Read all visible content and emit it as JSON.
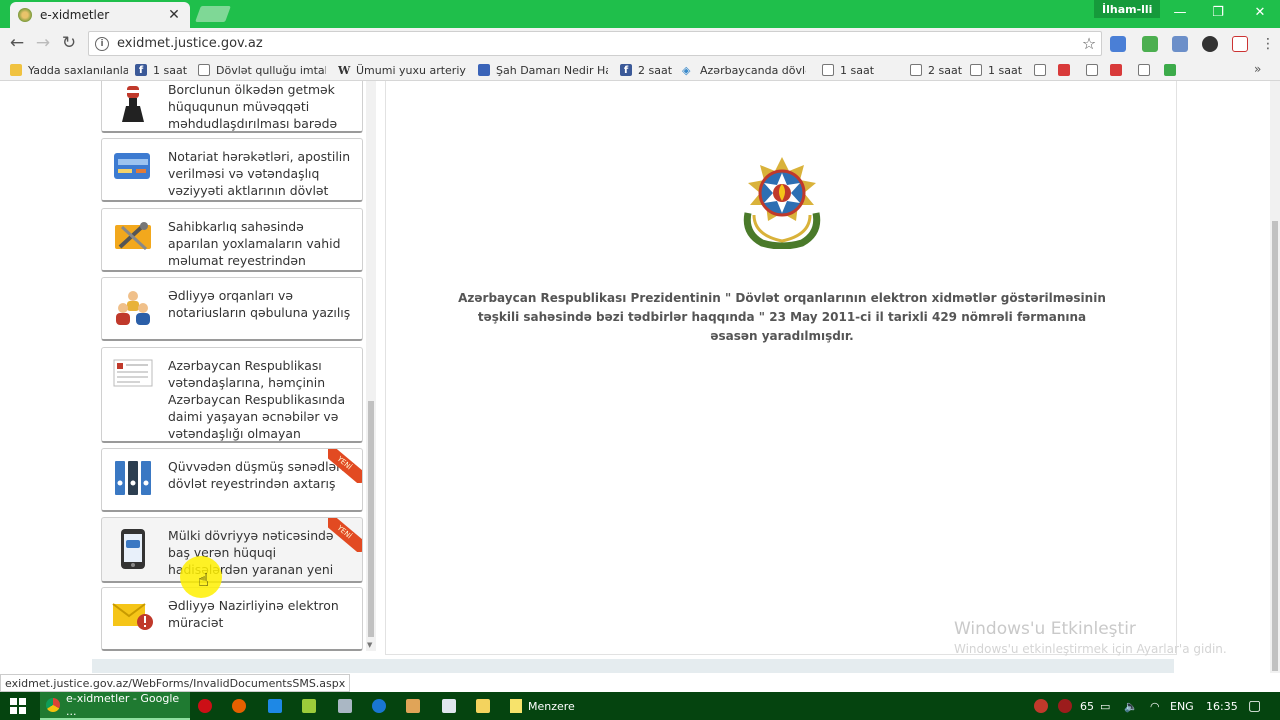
{
  "browser": {
    "tab_title": "e-xidmetler",
    "tab_close": "✕",
    "profile": "İlham-lli",
    "url": "exidmet.justice.gov.az",
    "window_min": "—",
    "window_restore": "❐",
    "window_close": "✕",
    "back": "←",
    "forward": "→",
    "reload": "↻",
    "star": "☆",
    "info": "i",
    "more_bookmarks": "»"
  },
  "bookmarks": [
    {
      "label": "Yadda saxlanılanlar",
      "icon": "folder-icon"
    },
    {
      "label": "1 saat",
      "icon": "facebook-icon"
    },
    {
      "label": "Dövlət qulluğu imtahanı",
      "icon": "page-icon"
    },
    {
      "label": "Ümumi yuxu arteriyası",
      "icon": "wikipedia-icon"
    },
    {
      "label": "Şah Damarı Nedir Hal...",
      "icon": "globe-icon"
    },
    {
      "label": "2 saat",
      "icon": "facebook-icon"
    },
    {
      "label": "Azərbaycanda dövlət ...",
      "icon": "wifi-icon"
    },
    {
      "label": "1 saat",
      "icon": "page-icon"
    },
    {
      "label": "2 saat",
      "icon": "page-icon"
    },
    {
      "label": "1 saat",
      "icon": "page-icon"
    }
  ],
  "services": [
    {
      "label": "Borclunun ölkədən getmək hüququnun müvəqqəti məhdudlaşdırılması barədə",
      "icon": "stamp-icon",
      "ribbon": ""
    },
    {
      "label": "Notariat hərəkətləri, apostilin verilməsi və vətəndaşlıq vəziyyəti aktlarının dövlət",
      "icon": "id-card-icon",
      "ribbon": ""
    },
    {
      "label": "Sahibkarlıq sahəsində aparılan yoxlamaların vahid məlumat reyestrindən",
      "icon": "tools-icon",
      "ribbon": ""
    },
    {
      "label": "Ədliyyə orqanları və notariusların qəbuluna yazılış",
      "icon": "people-icon",
      "ribbon": ""
    },
    {
      "label": "Azərbaycan Respublikası vətəndaşlarına, həmçinin Azərbaycan Respublikasında daimi yaşayan əcnəbilər və vətəndaşlığı olmayan şəxslərə",
      "icon": "document-icon",
      "ribbon": ""
    },
    {
      "label": "Qüvvədən düşmüş sənədlərin dövlət reyestrindən axtarış",
      "icon": "binders-icon",
      "ribbon": "YENİ"
    },
    {
      "label": "Mülki dövriyyə nəticəsində baş verən hüquqi hadisələrdən yaranan yeni",
      "icon": "sms-phone-icon",
      "ribbon": "YENİ"
    },
    {
      "label": "Ədliyyə Nazirliyinə elektron müraciət",
      "icon": "mail-alert-icon",
      "ribbon": ""
    }
  ],
  "main": {
    "decree_text": "Azərbaycan Respublikası Prezidentinin \" Dövlət orqanlarının elektron xidmətlər göstərilməsinin təşkili sahəsində bəzi tədbirlər haqqında \" 23 May 2011-ci il tarixli 429 nömrəli fərmanına əsasən yaradılmışdır."
  },
  "status_url": "exidmet.justice.gov.az/WebForms/InvalidDocumentsSMS.aspx",
  "watermark": {
    "title": "Windows'u Etkinleştir",
    "subtitle": "Windows'u etkinleştirmek için Ayarlar'a gidin."
  },
  "taskbar": {
    "chrome_label": "e-xidmetler - Google ...",
    "menzere_label": "Menzere",
    "tray_number": "65",
    "language": "ENG",
    "time": "16:35"
  },
  "colors": {
    "chrome_green": "#1fbf4b",
    "taskbar": "#05440f",
    "ribbon": "#e24a22"
  }
}
